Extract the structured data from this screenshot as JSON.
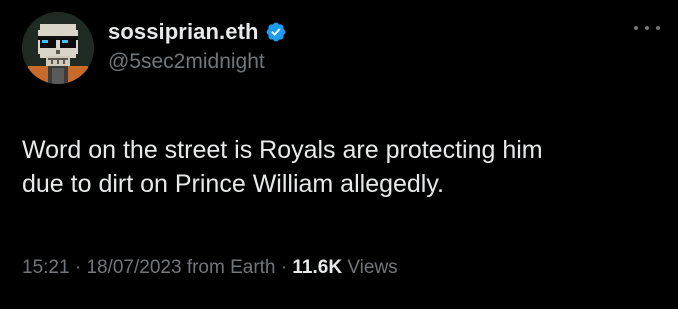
{
  "tweet": {
    "author": {
      "display_name": "sossiprian.eth",
      "handle": "@5sec2midnight",
      "verified": true,
      "avatar_icon": "pixel-skull-sunglasses-avatar"
    },
    "text_line1": "Word on the street is Royals are protecting him",
    "text_line2": "due to dirt on Prince William allegedly.",
    "time": "15:21",
    "separator": "·",
    "date": "18/07/2023",
    "source": "from Earth",
    "views_count": "11.6K",
    "views_label": "Views",
    "more_icon": "more-dots-icon"
  },
  "colors": {
    "background": "#000000",
    "primary_text": "#e7e9ea",
    "secondary_text": "#71767b",
    "verified_badge": "#1d9bf0"
  }
}
